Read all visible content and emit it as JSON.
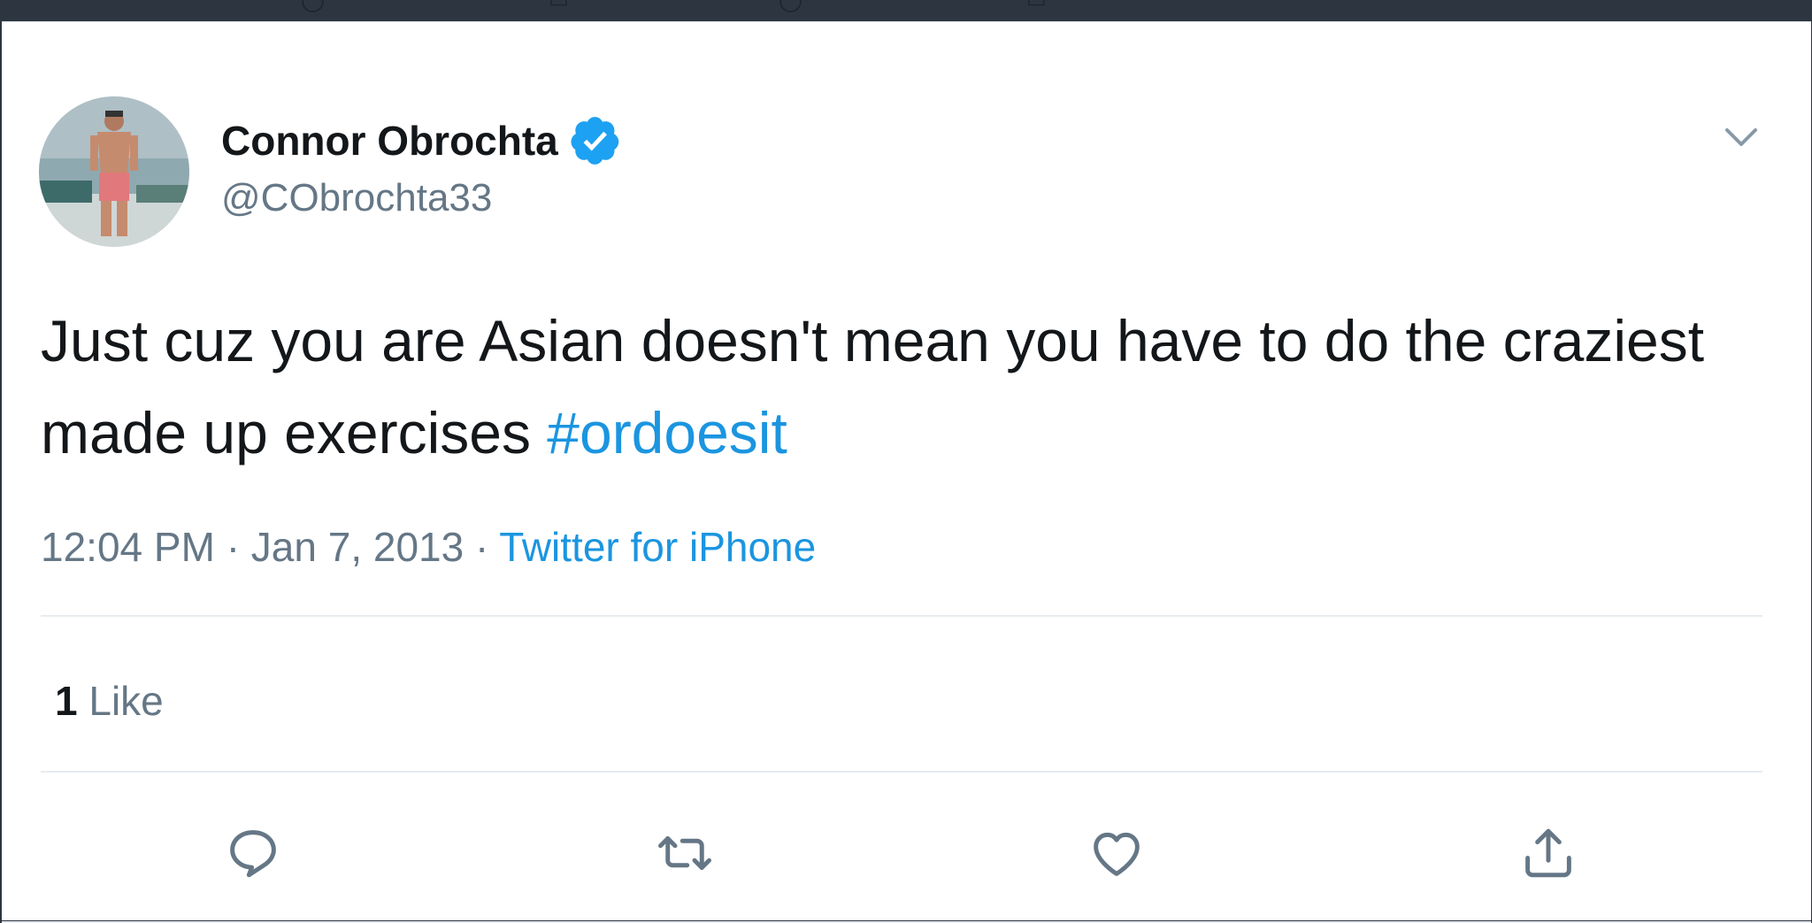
{
  "tweet": {
    "author_name": "Connor Obrochta",
    "handle": "@CObrochta33",
    "text_main": "Just cuz you are Asian doesn't mean you have to do the craziest made up exercises ",
    "hashtag": "#ordoesit",
    "time": "12:04 PM",
    "separator": "·",
    "date": "Jan 7, 2013",
    "source": "Twitter for iPhone",
    "likes_count": "1",
    "likes_label": "Like"
  },
  "icons": {
    "verified": "verified-badge-icon",
    "caret": "chevron-down-icon",
    "reply": "reply-icon",
    "retweet": "retweet-icon",
    "like": "heart-icon",
    "share": "share-icon"
  },
  "colors": {
    "link": "#1b95e0",
    "text": "#14171a",
    "secondary": "#657786",
    "verified": "#1da1f2"
  }
}
